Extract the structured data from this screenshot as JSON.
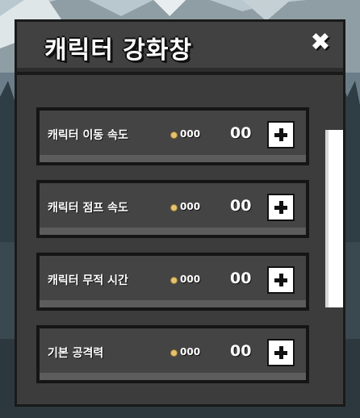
{
  "window": {
    "title": "캐릭터 강화창",
    "close_icon": "close-icon"
  },
  "upgrades": [
    {
      "label": "캐릭터 이동 속도",
      "cost": "000",
      "level": "00"
    },
    {
      "label": "캐릭터 점프 속도",
      "cost": "000",
      "level": "00"
    },
    {
      "label": "캐릭터 무적 시간",
      "cost": "000",
      "level": "00"
    },
    {
      "label": "기본 공격력",
      "cost": "000",
      "level": "00"
    }
  ],
  "colors": {
    "panel": "#3c3c3c",
    "item": "#444444",
    "coin": "#e6c270",
    "text": "#ffffff"
  },
  "scrollbar": {
    "position_fraction": 0.1
  }
}
